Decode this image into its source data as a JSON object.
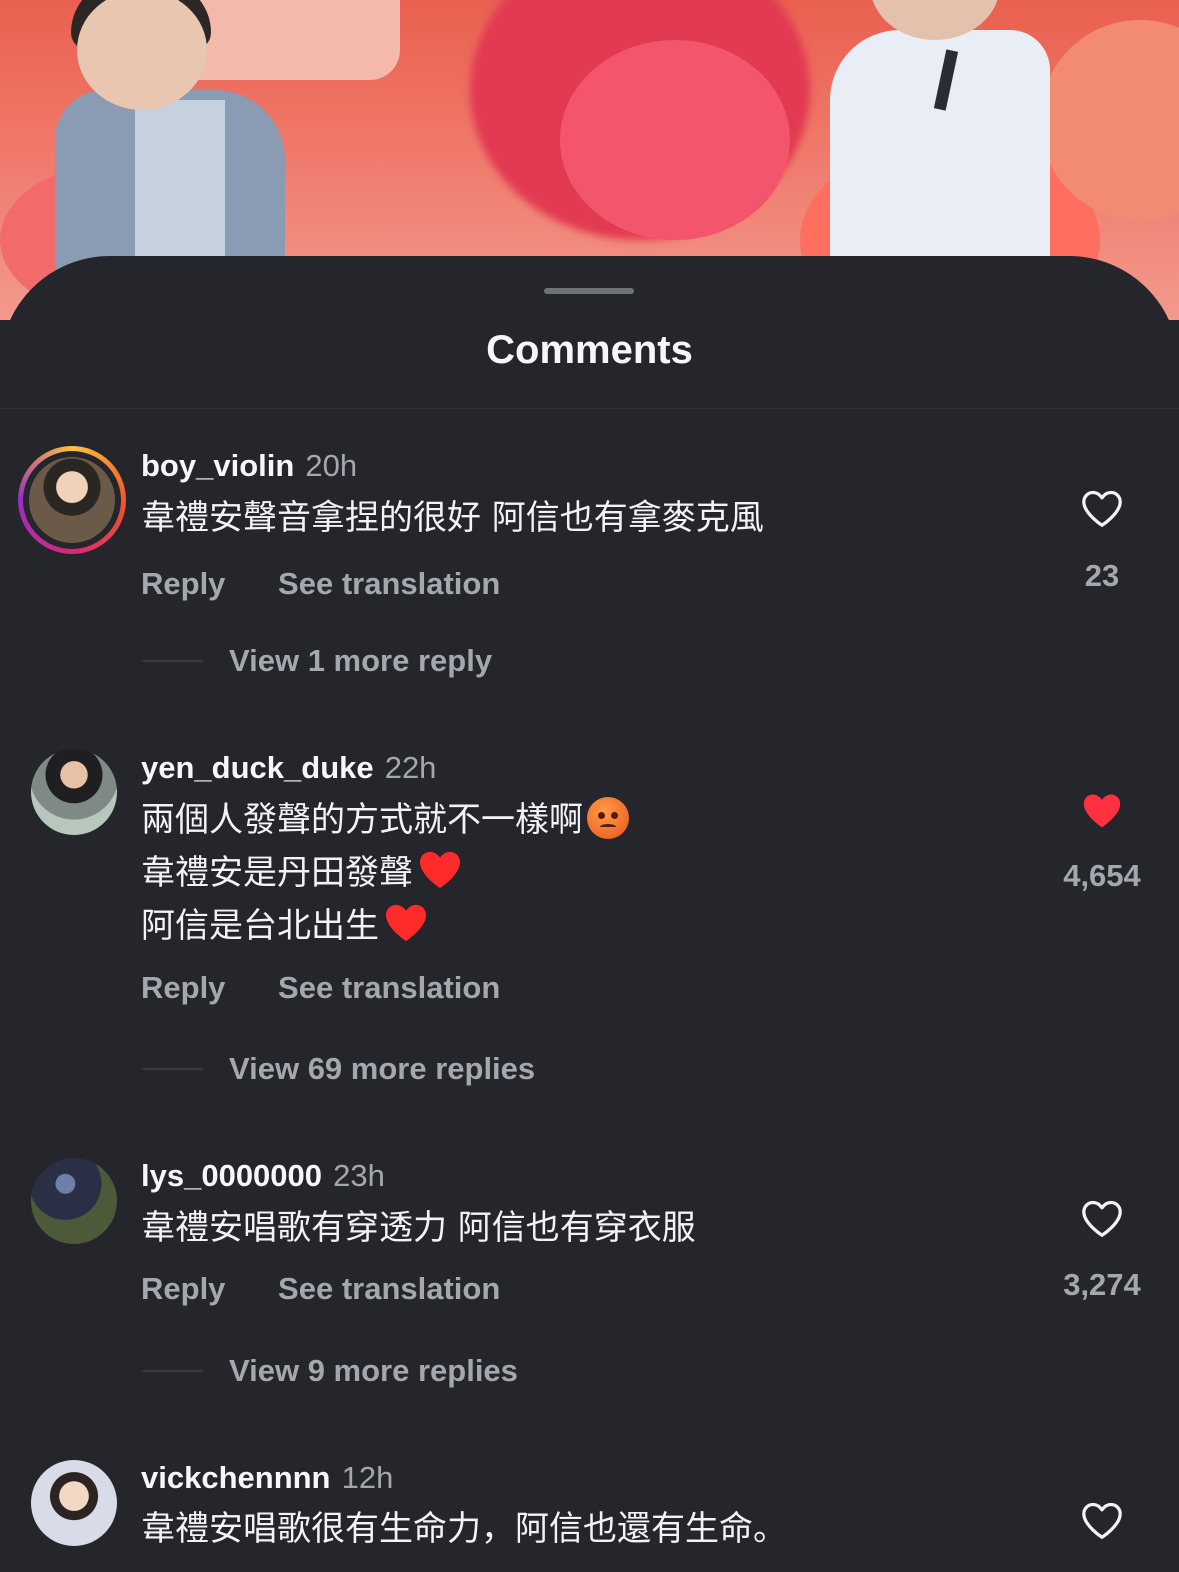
{
  "sheet": {
    "title": "Comments"
  },
  "colors": {
    "liked_heart": "#ff3040",
    "sheet_bg": "#24262b",
    "muted_text": "#a3a7ae"
  },
  "comments": [
    {
      "username": "boy_violin",
      "time": "20h",
      "lines": [
        "韋禮安聲音拿捏的很好 阿信也有拿麥克風"
      ],
      "reply_label": "Reply",
      "translate_label": "See translation",
      "likes": "23",
      "liked": false,
      "has_story_ring": true,
      "view_replies": "View 1 more reply"
    },
    {
      "username": "yen_duck_duke",
      "time": "22h",
      "lines": [
        "兩個人發聲的方式就不一樣啊",
        "韋禮安是丹田發聲",
        "阿信是台北出生"
      ],
      "emojis": [
        "angry-face-emoji",
        "red-heart-emoji",
        "red-heart-emoji"
      ],
      "reply_label": "Reply",
      "translate_label": "See translation",
      "likes": "4,654",
      "liked": true,
      "view_replies": "View 69 more replies"
    },
    {
      "username": "lys_0000000",
      "time": "23h",
      "lines": [
        "韋禮安唱歌有穿透力  阿信也有穿衣服"
      ],
      "reply_label": "Reply",
      "translate_label": "See translation",
      "likes": "3,274",
      "liked": false,
      "view_replies": "View 9 more replies"
    },
    {
      "username": "vickchennnn",
      "time": "12h",
      "lines": [
        "韋禮安唱歌很有生命力，阿信也還有生命。"
      ],
      "liked": false
    }
  ]
}
